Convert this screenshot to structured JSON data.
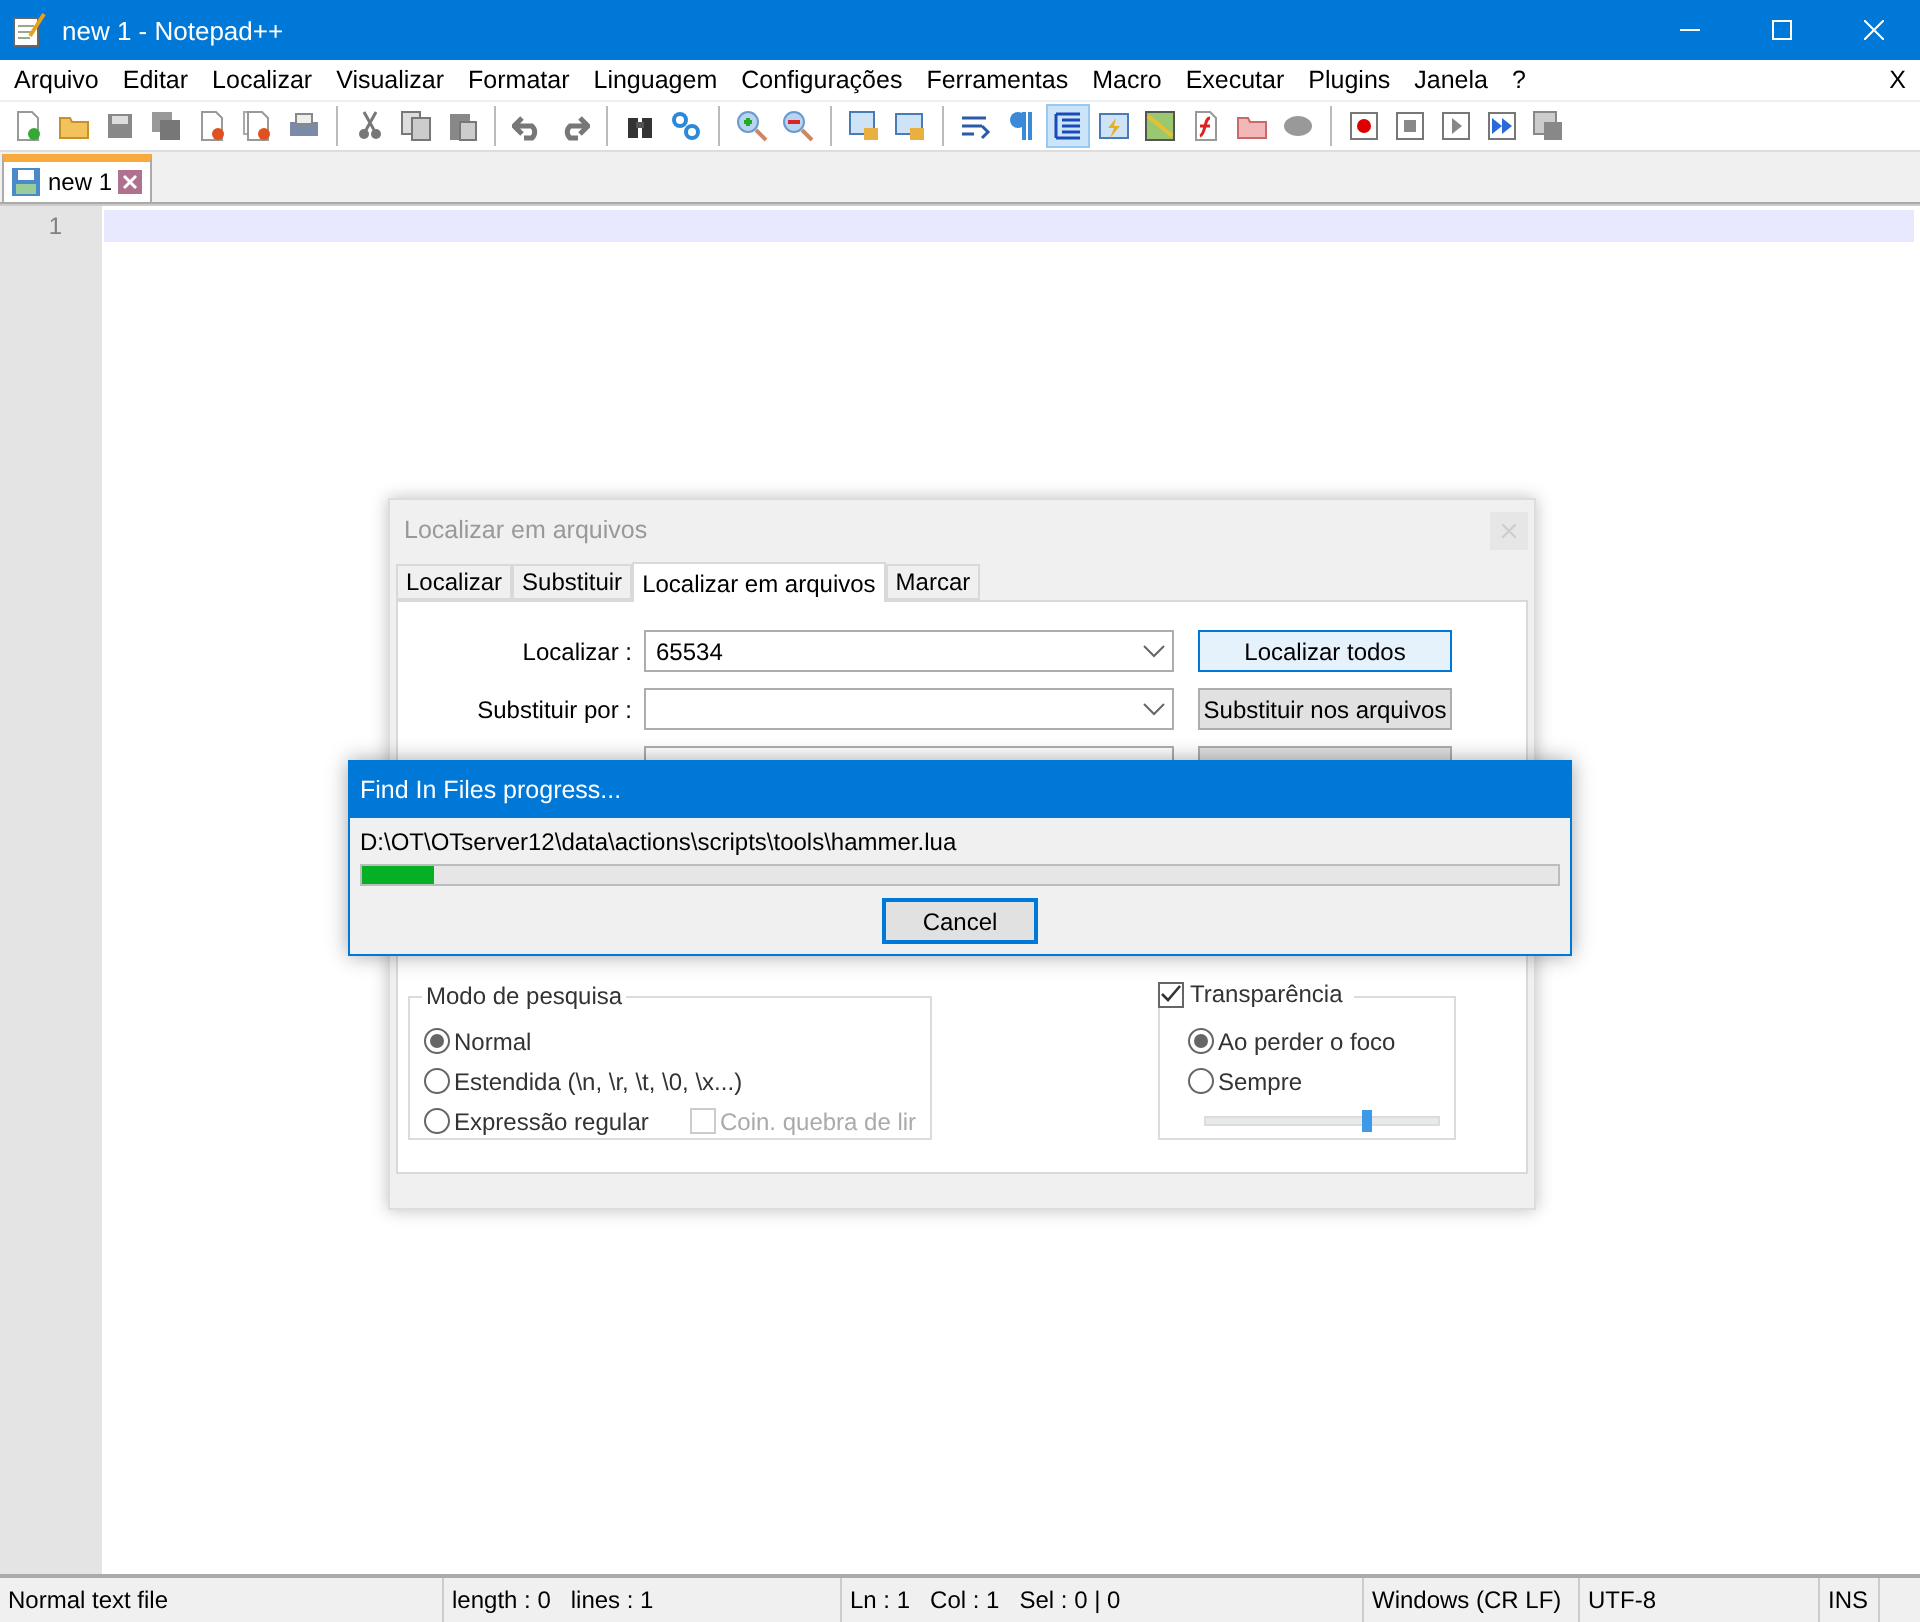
{
  "window": {
    "title": "new 1 - Notepad++"
  },
  "menu": [
    "Arquivo",
    "Editar",
    "Localizar",
    "Visualizar",
    "Formatar",
    "Linguagem",
    "Configurações",
    "Ferramentas",
    "Macro",
    "Executar",
    "Plugins",
    "Janela",
    "?"
  ],
  "menu_close": "X",
  "toolbar": [
    {
      "selected": false
    },
    {
      "selected": false
    },
    {
      "selected": false
    },
    {
      "selected": false
    },
    {
      "selected": false
    },
    {
      "selected": false
    },
    {
      "selected": false
    },
    {
      "selected": false
    },
    {
      "selected": false
    },
    {
      "selected": false
    },
    {
      "selected": false
    },
    {
      "selected": false
    },
    {
      "selected": false
    },
    {
      "selected": false
    },
    {
      "selected": false
    },
    {
      "selected": false
    },
    {
      "selected": false
    },
    {
      "selected": false
    },
    {
      "selected": false
    },
    {
      "selected": false
    },
    {
      "selected": true
    },
    {
      "selected": false
    },
    {
      "selected": false
    },
    {
      "selected": false
    },
    {
      "selected": false
    },
    {
      "selected": false
    },
    {
      "selected": false
    },
    {
      "selected": false
    },
    {
      "selected": false
    },
    {
      "selected": false
    },
    {
      "selected": false
    }
  ],
  "tabs": [
    {
      "label": "new 1",
      "selected": true
    }
  ],
  "editor": {
    "line_numbers": [
      "1"
    ]
  },
  "find_dialog": {
    "title": "Localizar em arquivos",
    "tabs": [
      {
        "label": "Localizar",
        "selected": false
      },
      {
        "label": "Substituir",
        "selected": false
      },
      {
        "label": "Localizar em arquivos",
        "selected": true
      },
      {
        "label": "Marcar",
        "selected": false
      }
    ],
    "fields": [
      {
        "label": "Localizar :",
        "value": "65534"
      },
      {
        "label": "Substituir por :"
      }
    ],
    "buttons": [
      {
        "label": "Localizar todos",
        "default": true
      },
      {
        "label": "Substituir nos arquivos",
        "default": false
      }
    ],
    "search_mode": {
      "title": "Modo de pesquisa",
      "options": [
        {
          "label": "Normal",
          "selected": true
        },
        {
          "label": "Estendida  (\\n, \\r, \\t, \\0, \\x...)",
          "selected": false
        },
        {
          "label": "Expressão regular",
          "selected": false
        }
      ],
      "match_newline": {
        "label": "Coin. quebra de lir",
        "checked": false,
        "disabled": true
      }
    },
    "transparency": {
      "label": "Transparência",
      "checked": true,
      "options": [
        {
          "label": "Ao perder o foco",
          "selected": true
        },
        {
          "label": "Sempre",
          "selected": false
        }
      ],
      "level": 0.7
    }
  },
  "progress": {
    "title": "Find In Files progress...",
    "path": "D:\\OT\\OTserver12\\data\\actions\\scripts\\tools\\hammer.lua",
    "level": 0.06,
    "button": "Cancel"
  },
  "status_bar": [
    {
      "parts": [
        "Normal text file"
      ]
    },
    {
      "parts": [
        "length : 0",
        "lines : 1"
      ]
    },
    {
      "parts": [
        "Ln : 1",
        "Col : 1",
        "Sel : 0 | 0"
      ]
    },
    {
      "parts": [
        "Windows (CR LF)"
      ]
    },
    {
      "parts": [
        "UTF-8"
      ]
    },
    {
      "parts": [
        "INS"
      ]
    }
  ]
}
